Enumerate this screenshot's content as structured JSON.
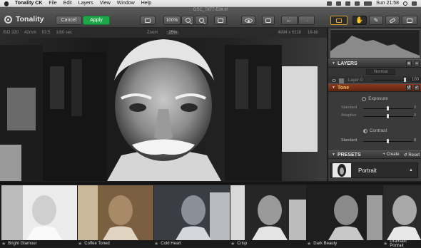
{
  "menubar": {
    "app_name": "Tonality CK",
    "items": [
      "File",
      "Edit",
      "Layers",
      "View",
      "Window",
      "Help"
    ],
    "clock": "Sun 21:58"
  },
  "toolbar": {
    "document_title": "DSC_7877-Edit.tif",
    "logo_text": "Tonality",
    "cancel_label": "Cancel",
    "apply_label": "Apply",
    "zoom_value": "100%"
  },
  "info": {
    "iso": "ISO 320",
    "focal": "42mm",
    "aperture": "f/3.5",
    "shutter": "1/80 sec",
    "zoom_label": "Zoom",
    "zoom_value": "25%",
    "dimensions": "4894 x 6118",
    "bitdepth": "16-bit"
  },
  "panel": {
    "layers_title": "LAYERS",
    "blend_mode": "Normal",
    "layer_name": "Layer 0",
    "opacity": "100",
    "tone_title": "Tone",
    "exposure_title": "Exposure",
    "contrast_title": "Contrast",
    "sliders": [
      {
        "label": "Standard",
        "value": "0"
      },
      {
        "label": "Adaptive",
        "value": "0"
      },
      {
        "label": "Standard",
        "value": "0"
      }
    ],
    "presets_title": "PRESETS",
    "create_label": "Create",
    "reset_label": "Reset",
    "preset_category": "Portrait"
  },
  "filmstrip": [
    {
      "label": "Bright Glamour"
    },
    {
      "label": "Coffee Toned"
    },
    {
      "label": "Cold Heart"
    },
    {
      "label": "Crisp"
    },
    {
      "label": "Dark Beauty"
    },
    {
      "label": "Dramatic Portrait"
    }
  ]
}
